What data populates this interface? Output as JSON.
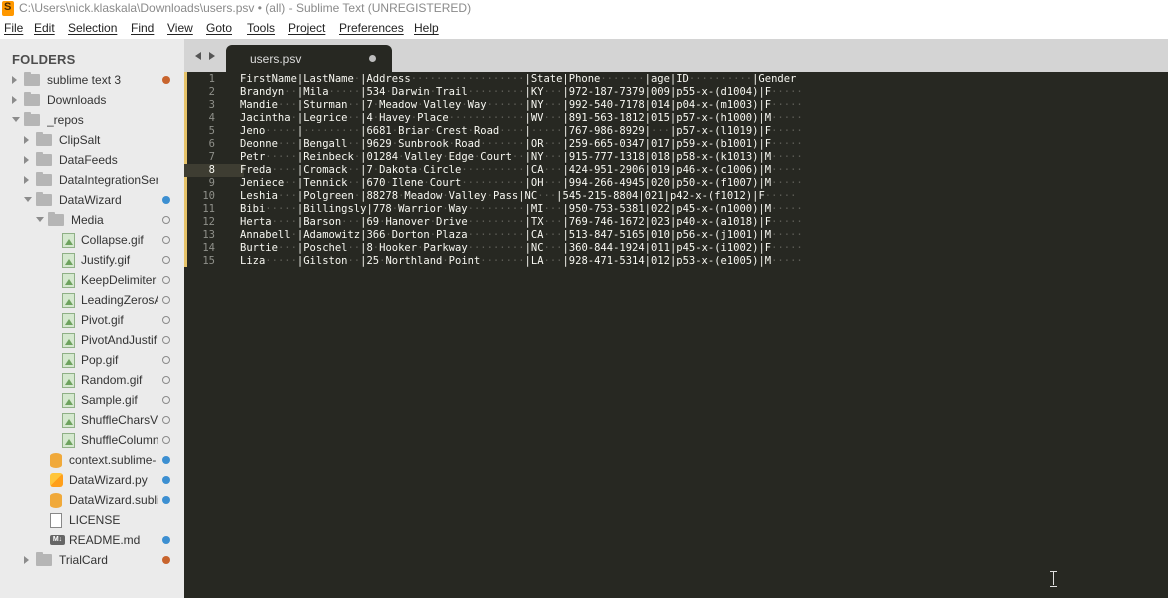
{
  "window": {
    "title": "C:\\Users\\nick.klaskala\\Downloads\\users.psv • (all) - Sublime Text (UNREGISTERED)"
  },
  "menu": [
    "File",
    "Edit",
    "Selection",
    "Find",
    "View",
    "Goto",
    "Tools",
    "Project",
    "Preferences",
    "Help"
  ],
  "sidebar": {
    "title": "FOLDERS",
    "items": [
      {
        "label": "sublime text 3",
        "type": "folder",
        "state": "closed",
        "depth": 0,
        "dot": "orange"
      },
      {
        "label": "Downloads",
        "type": "folder",
        "state": "closed",
        "depth": 0,
        "dot": ""
      },
      {
        "label": "_repos",
        "type": "folder",
        "state": "open",
        "depth": 0,
        "dot": ""
      },
      {
        "label": "ClipSalt",
        "type": "folder",
        "state": "closed",
        "depth": 1,
        "dot": ""
      },
      {
        "label": "DataFeeds",
        "type": "folder",
        "state": "closed",
        "depth": 1,
        "dot": ""
      },
      {
        "label": "DataIntegrationServiceS",
        "type": "folder",
        "state": "closed",
        "depth": 1,
        "dot": ""
      },
      {
        "label": "DataWizard",
        "type": "folder",
        "state": "open",
        "depth": 1,
        "dot": "blue"
      },
      {
        "label": "Media",
        "type": "folder",
        "state": "open",
        "depth": 2,
        "dot": "hollow"
      },
      {
        "label": "Collapse.gif",
        "type": "gif",
        "depth": 3,
        "dot": "hollow"
      },
      {
        "label": "Justify.gif",
        "type": "gif",
        "depth": 3,
        "dot": "hollow"
      },
      {
        "label": "KeepDelimiter",
        "type": "gif",
        "depth": 3,
        "dot": "hollow"
      },
      {
        "label": "LeadingZerosA",
        "type": "gif",
        "depth": 3,
        "dot": "hollow"
      },
      {
        "label": "Pivot.gif",
        "type": "gif",
        "depth": 3,
        "dot": "hollow"
      },
      {
        "label": "PivotAndJustif",
        "type": "gif",
        "depth": 3,
        "dot": "hollow"
      },
      {
        "label": "Pop.gif",
        "type": "gif",
        "depth": 3,
        "dot": "hollow"
      },
      {
        "label": "Random.gif",
        "type": "gif",
        "depth": 3,
        "dot": "hollow"
      },
      {
        "label": "Sample.gif",
        "type": "gif",
        "depth": 3,
        "dot": "hollow"
      },
      {
        "label": "ShuffleCharsVe",
        "type": "gif",
        "depth": 3,
        "dot": "hollow"
      },
      {
        "label": "ShuffleColumn",
        "type": "gif",
        "depth": 3,
        "dot": "hollow"
      },
      {
        "label": "context.sublime-",
        "type": "db",
        "depth": 2,
        "dot": "blue"
      },
      {
        "label": "DataWizard.py",
        "type": "py",
        "depth": 2,
        "dot": "blue"
      },
      {
        "label": "DataWizard.subli",
        "type": "db",
        "depth": 2,
        "dot": "blue"
      },
      {
        "label": "LICENSE",
        "type": "txt",
        "depth": 2,
        "dot": ""
      },
      {
        "label": "README.md",
        "type": "md",
        "depth": 2,
        "dot": "blue"
      },
      {
        "label": "TrialCard",
        "type": "folder",
        "state": "closed",
        "depth": 1,
        "dot": "orange"
      }
    ]
  },
  "tab": {
    "label": "users.psv"
  },
  "editor": {
    "current_line": 8,
    "lines": [
      "FirstName|LastName·|Address··················|State|Phone·······|age|ID··········|Gender",
      "Brandyn··|Mila·····|534·Darwin·Trail·········|KY···|972-187-7379|009|p55-x-(d1004)|F·····",
      "Mandie···|Sturman··|7·Meadow·Valley·Way······|NY···|992-540-7178|014|p04-x-(m1003)|F·····",
      "Jacintha·|Legrice··|4·Havey·Place············|WV···|891-563-1812|015|p57-x-(h1000)|M·····",
      "Jeno·····|·········|6681·Briar·Crest·Road····|·····|767-986-8929|···|p57-x-(l1019)|F·····",
      "Deonne···|Bengall··|9629·Sunbrook·Road·······|OR···|259-665-0347|017|p59-x-(b1001)|F·····",
      "Petr·····|Reinbeck·|01284·Valley·Edge·Court··|NY···|915-777-1318|018|p58-x-(k1013)|M·····",
      "Freda····|Cromack··|7·Dakota·Circle··········|CA···|424-951-2906|019|p46-x-(c1006)|M·····",
      "Jeniece··|Tennick··|670·Ilene·Court··········|OH···|994-266-4945|020|p50-x-(f1007)|M·····",
      "Leshia···|Polgreen·|88278·Meadow·Valley·Pass|NC···|545-215-8804|021|p42-x-(f1012)|F·····",
      "Bibi·····|Billingsly|778·Warrior·Way·········|MI···|950-753-5381|022|p45-x-(n1000)|M·····",
      "Herta····|Barson···|69·Hanover·Drive·········|TX···|769-746-1672|023|p40-x-(a1018)|F·····",
      "Annabell·|Adamowitz|366·Dorton·Plaza·········|CA···|513-847-5165|010|p56-x-(j1001)|M·····",
      "Burtie···|Poschel··|8·Hooker·Parkway·········|NC···|360-844-1924|011|p45-x-(i1002)|F·····",
      "Liza·····|Gilston··|25·Northland·Point·······|LA···|928-471-5314|012|p53-x-(e1005)|M·····"
    ]
  },
  "colors": {
    "editor_bg": "#272822",
    "sidebar_bg": "#ebebeb",
    "modified_gutter": "#e6c36a",
    "dot_orange": "#c8642d",
    "dot_blue": "#3c8fd1"
  }
}
